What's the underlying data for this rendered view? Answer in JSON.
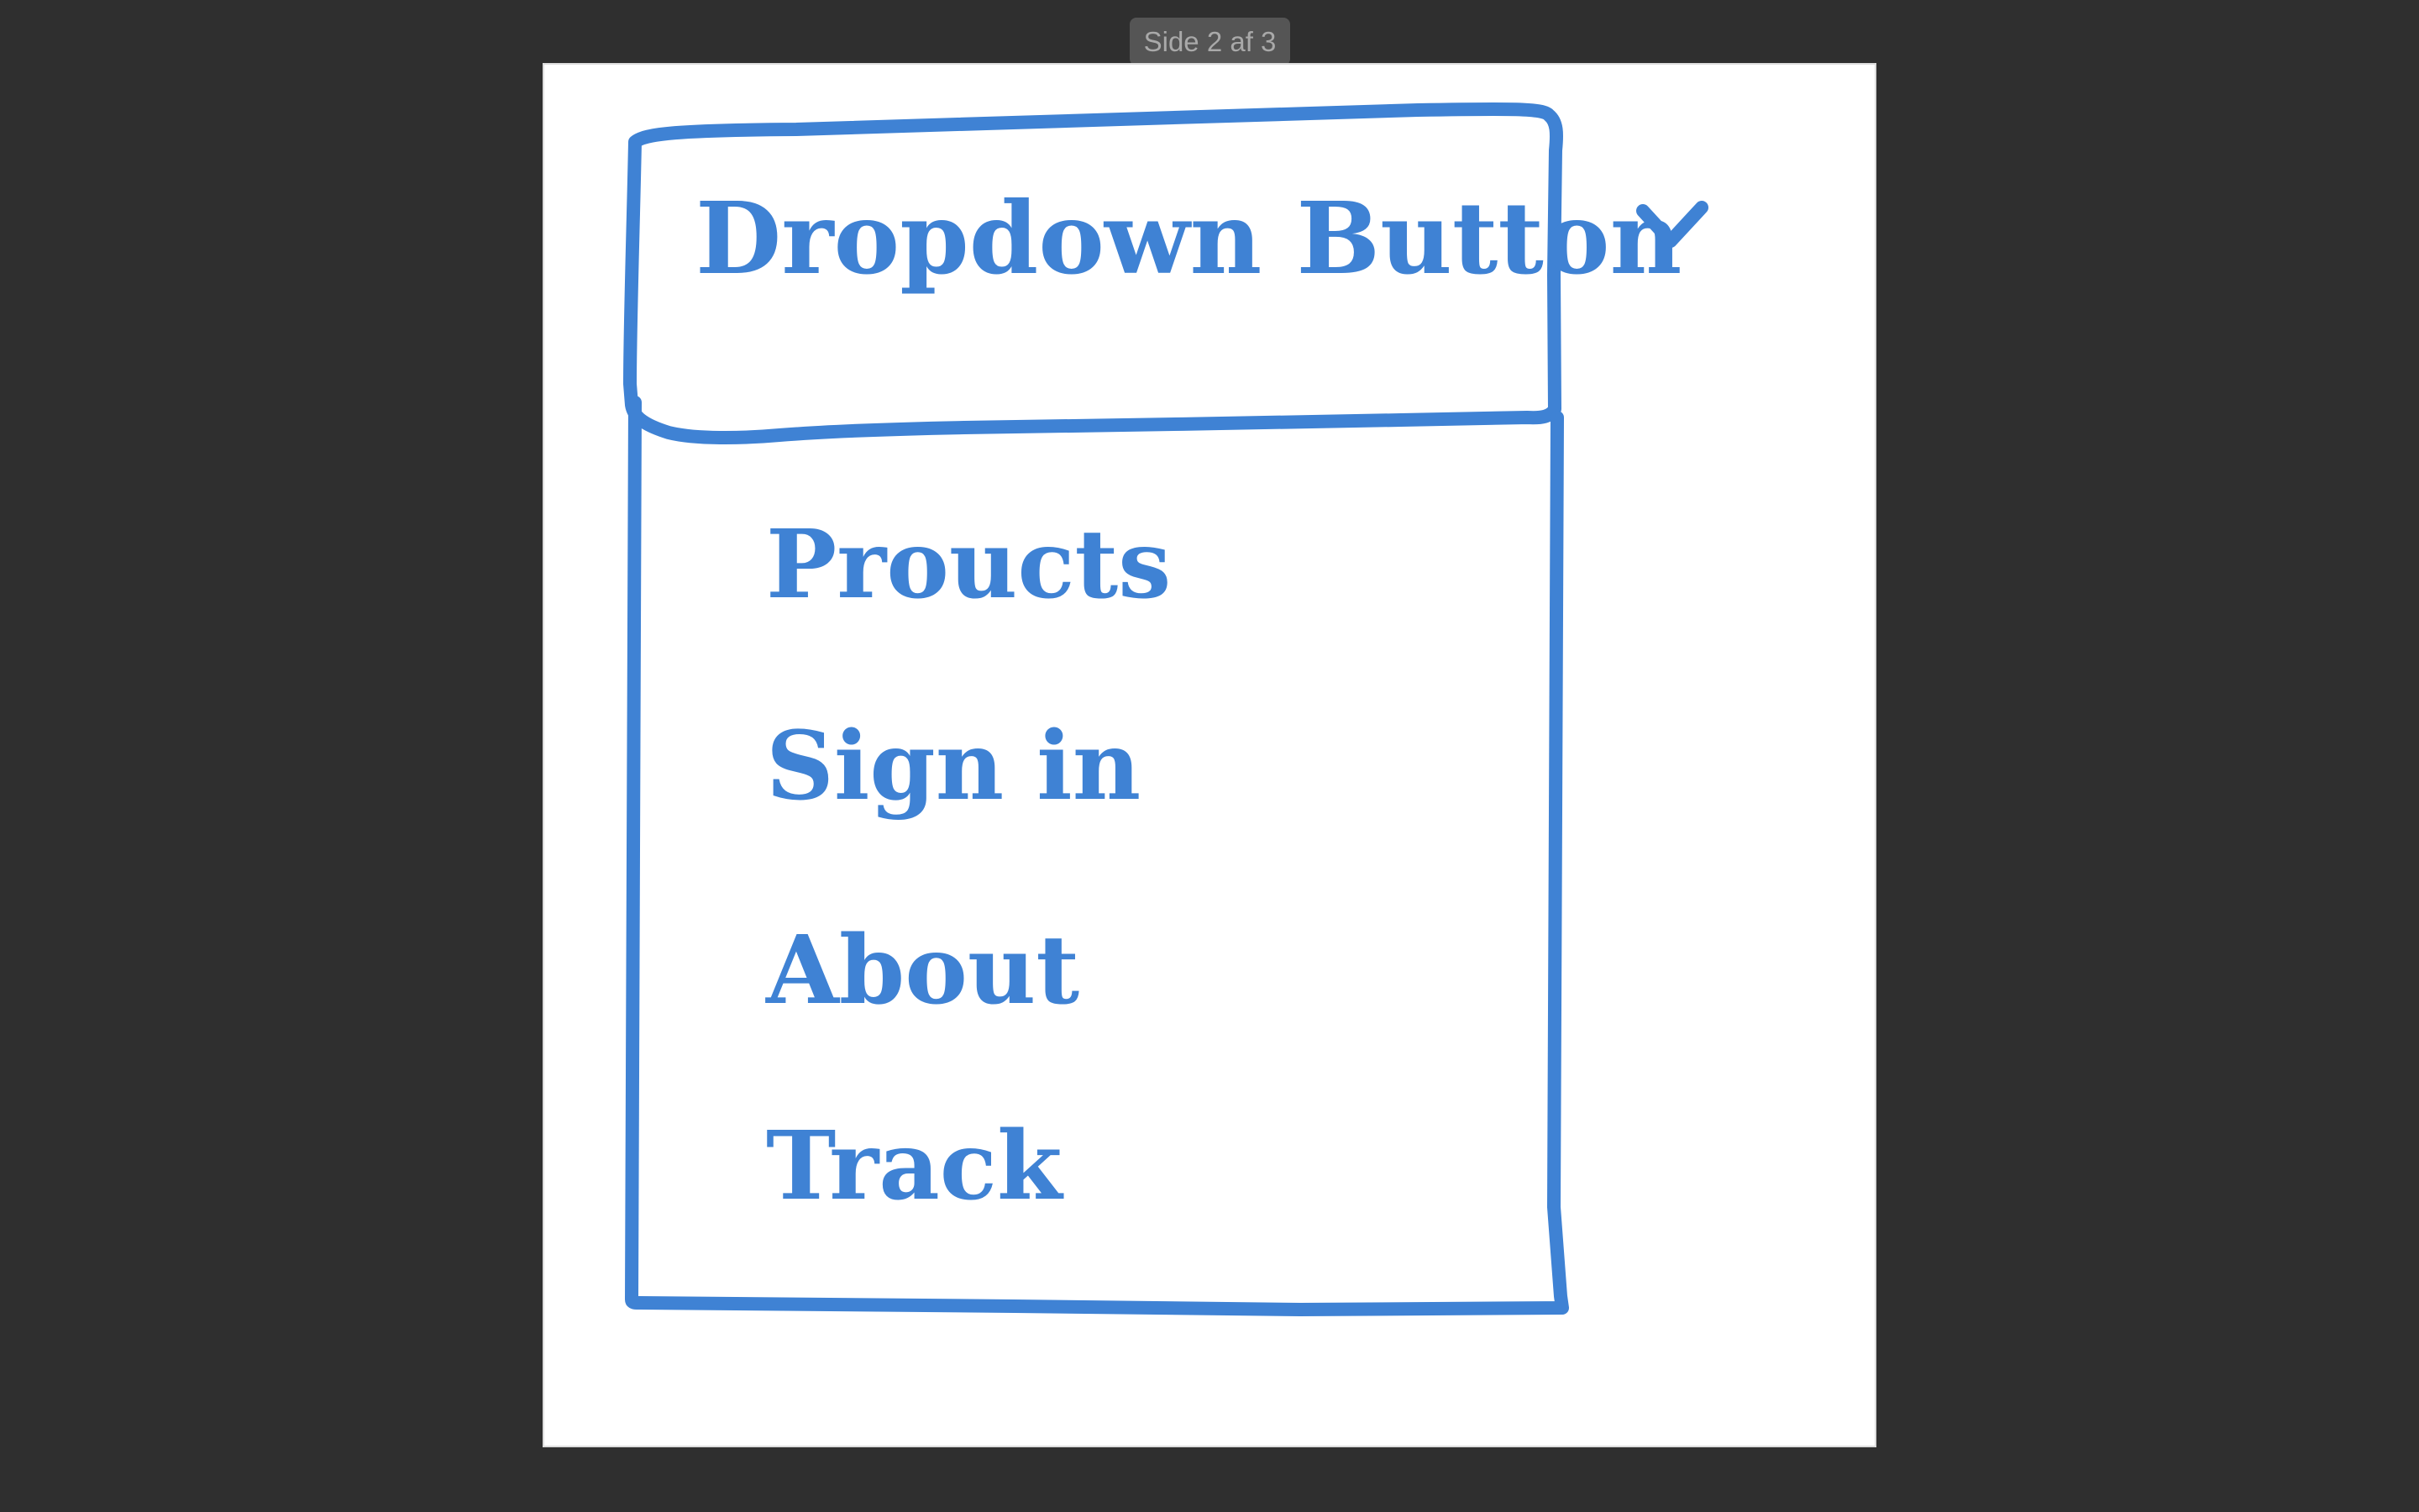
{
  "viewer": {
    "page_indicator": "Side 2 af 3"
  },
  "dropdown": {
    "button_label": "Dropdown Button",
    "button_icon": "chevron-down-icon",
    "items": [
      {
        "label": "Proucts"
      },
      {
        "label": "Sign in"
      },
      {
        "label": "About"
      },
      {
        "label": "Track"
      }
    ]
  },
  "colors": {
    "sketch_blue": "#3f82d4",
    "background": "#2f2f2f",
    "page": "#ffffff"
  }
}
